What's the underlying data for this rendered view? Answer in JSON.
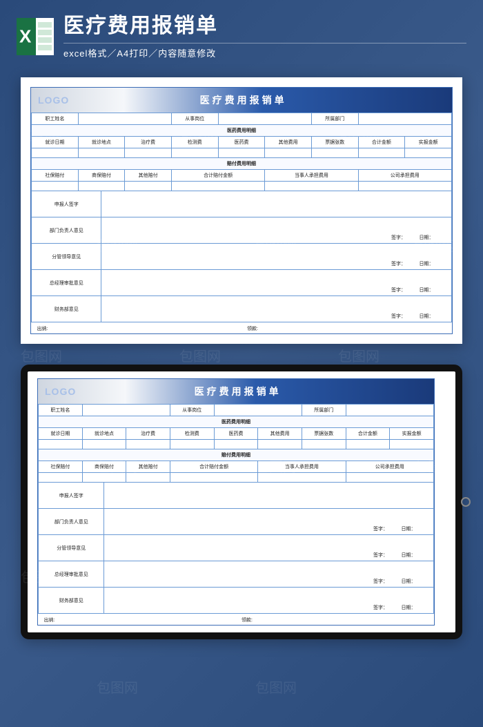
{
  "header": {
    "title": "医疗费用报销单",
    "subtitle": "excel格式／A4打印／内容随意修改"
  },
  "form": {
    "logo": "LOGO",
    "title": "医疗费用报销单",
    "row1": {
      "employee_name": "职工姓名",
      "position": "从事岗位",
      "department": "所属部门"
    },
    "section1": "医药费用明细",
    "detail_headers": {
      "date": "就诊日期",
      "place": "就诊地点",
      "treatment": "治疗费",
      "test": "检测费",
      "medicine": "医药费",
      "other": "其他费用",
      "receipts": "票据张数",
      "total": "合计金额",
      "actual": "实报金额"
    },
    "section2": "赔付费用明细",
    "pay_headers": {
      "social": "社保赔付",
      "commercial": "商保赔付",
      "other": "其他赔付",
      "total_pay": "合计赔付金额",
      "person": "当事人承担费用",
      "company": "公司承担费用"
    },
    "approvals": {
      "applicant": "申报人签字",
      "dept_head": "部门负责人意见",
      "branch": "分管领导意见",
      "gm": "总经理审批意见",
      "finance": "财务部意见"
    },
    "sign_label": "签字：",
    "date_label": "日期：",
    "footer": {
      "cashier": "出纳:",
      "receiver": "领款:"
    }
  },
  "watermark": "包图网"
}
